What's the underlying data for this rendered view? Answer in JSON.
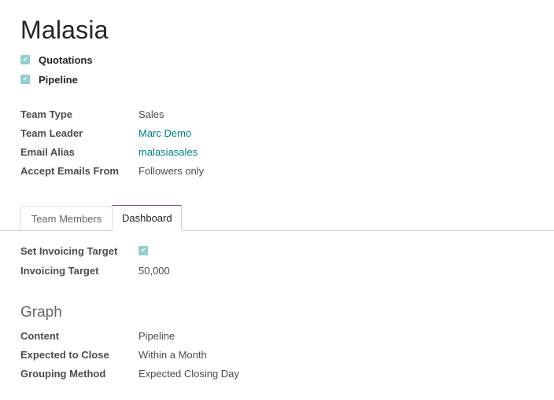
{
  "record": {
    "title": "Malasia"
  },
  "options": [
    {
      "label": "Quotations",
      "checked": true,
      "icon": "check-icon"
    },
    {
      "label": "Pipeline",
      "checked": true,
      "icon": "check-icon"
    }
  ],
  "fields": {
    "team_type": {
      "label": "Team Type",
      "value": "Sales"
    },
    "team_leader": {
      "label": "Team Leader",
      "value": "Marc Demo"
    },
    "email_alias": {
      "label": "Email Alias",
      "value": "malasiasales"
    },
    "accept_emails_from": {
      "label": "Accept Emails From",
      "value": "Followers only"
    }
  },
  "tabs": [
    {
      "label": "Team Members",
      "active": false
    },
    {
      "label": "Dashboard",
      "active": true
    }
  ],
  "dashboard": {
    "set_invoicing_target": {
      "label": "Set Invoicing Target",
      "checked": true
    },
    "invoicing_target": {
      "label": "Invoicing Target",
      "value": "50,000"
    }
  },
  "graph": {
    "title": "Graph",
    "content": {
      "label": "Content",
      "value": "Pipeline"
    },
    "expected_to_close": {
      "label": "Expected to Close",
      "value": "Within a Month"
    },
    "grouping_method": {
      "label": "Grouping Method",
      "value": "Expected Closing Day"
    }
  },
  "colors": {
    "checkbox": "#96cdce",
    "link": "#017e84",
    "active_tab_accent": "#875a7b"
  }
}
